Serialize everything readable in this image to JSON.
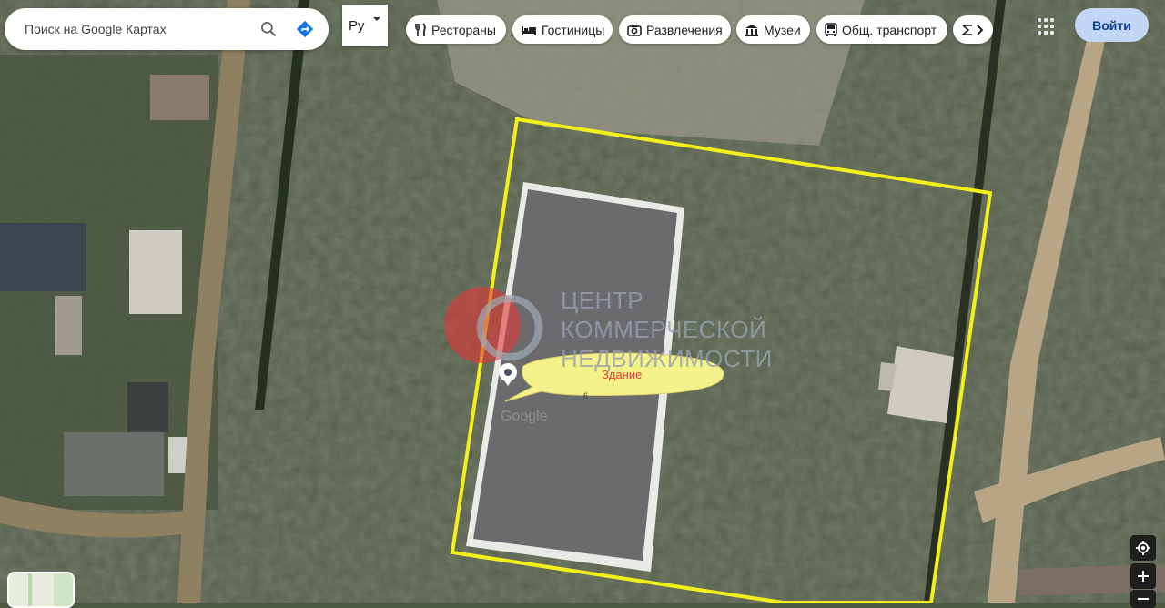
{
  "search": {
    "placeholder": "Поиск на Google Картах"
  },
  "language": {
    "label": "Py"
  },
  "chips": [
    {
      "label": "Рестораны",
      "icon": "fork-knife-icon"
    },
    {
      "label": "Гостиницы",
      "icon": "bed-icon"
    },
    {
      "label": "Развлечения",
      "icon": "camera-icon"
    },
    {
      "label": "Музеи",
      "icon": "museum-icon"
    },
    {
      "label": "Общ. транспорт",
      "icon": "bus-icon"
    },
    {
      "label": "",
      "icon": "more-icon"
    }
  ],
  "header": {
    "sign_in": "Войти"
  },
  "watermark": {
    "lines": [
      "ЦЕНТР",
      "КОММЕРЧЕСКОЙ",
      "НЕДВИЖИМОСТИ"
    ]
  },
  "marker": {
    "label": "Здание",
    "sub": "6"
  },
  "map_attribution": "Google",
  "colors": {
    "accent": "#1a73e8",
    "boundary": "#f2ef1a",
    "signin_bg": "#c2d7f5",
    "marker_label": "#e23a3a"
  }
}
